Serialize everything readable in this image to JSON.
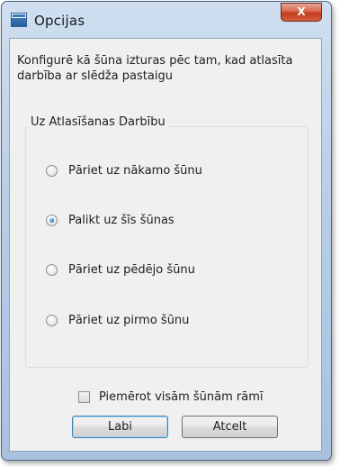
{
  "window": {
    "title": "Opcijas",
    "close_label": "X"
  },
  "description": "Konfigurē kā šūna izturas pēc tam, kad atlasīta darbība ar slēdža pastaigu",
  "group": {
    "label": "Uz Atlasīšanas Darbību",
    "options": [
      {
        "label": "Pāriet uz nākamo šūnu",
        "checked": false
      },
      {
        "label": "Palikt uz šīs šūnas",
        "checked": true
      },
      {
        "label": "Pāriet uz pēdējo šūnu",
        "checked": false
      },
      {
        "label": "Pāriet uz pirmo šūnu",
        "checked": false
      }
    ]
  },
  "checkbox": {
    "label": "Piemērot visām šūnām rāmī",
    "checked": false
  },
  "buttons": {
    "ok_label": "Labi",
    "cancel_label": "Atcelt"
  }
}
